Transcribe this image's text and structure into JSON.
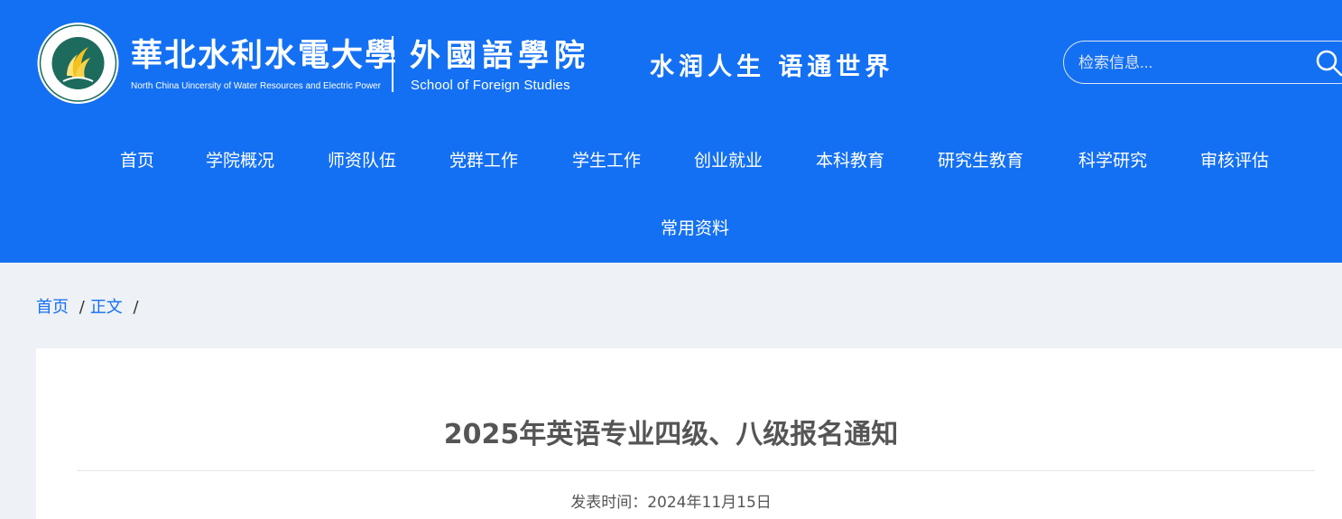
{
  "header": {
    "university_name_cn": "華北水利水電大學",
    "university_name_en": "North China Uincersity of Water Resources and Electric Power",
    "school_name_cn": "外國語學院",
    "school_name_en": "School of Foreign Studies",
    "motto": "水润人生  语通世界",
    "emblem_icon": "university-emblem",
    "emblem_text": "华北水利水电大学外国语学院 · SCHOOL OF FOREIGN STUDIES"
  },
  "search": {
    "placeholder": "检索信息...",
    "value": "",
    "icon": "search-icon"
  },
  "nav": {
    "items": [
      {
        "label": "首页"
      },
      {
        "label": "学院概况"
      },
      {
        "label": "师资队伍"
      },
      {
        "label": "党群工作"
      },
      {
        "label": "学生工作"
      },
      {
        "label": "创业就业"
      },
      {
        "label": "本科教育"
      },
      {
        "label": "研究生教育"
      },
      {
        "label": "科学研究"
      },
      {
        "label": "审核评估"
      },
      {
        "label": "常用资料"
      }
    ]
  },
  "breadcrumb": {
    "home": "首页",
    "current": "正文",
    "separator": "/"
  },
  "article": {
    "title": "2025年英语专业四级、八级报名通知",
    "meta_label": "发表时间：",
    "publish_date": "2024年11月15日"
  },
  "colors": {
    "header_bg": "#1470f3",
    "page_bg": "#eef1f5",
    "panel_bg": "#ffffff",
    "link": "#1470f3",
    "title_text": "#555555"
  }
}
